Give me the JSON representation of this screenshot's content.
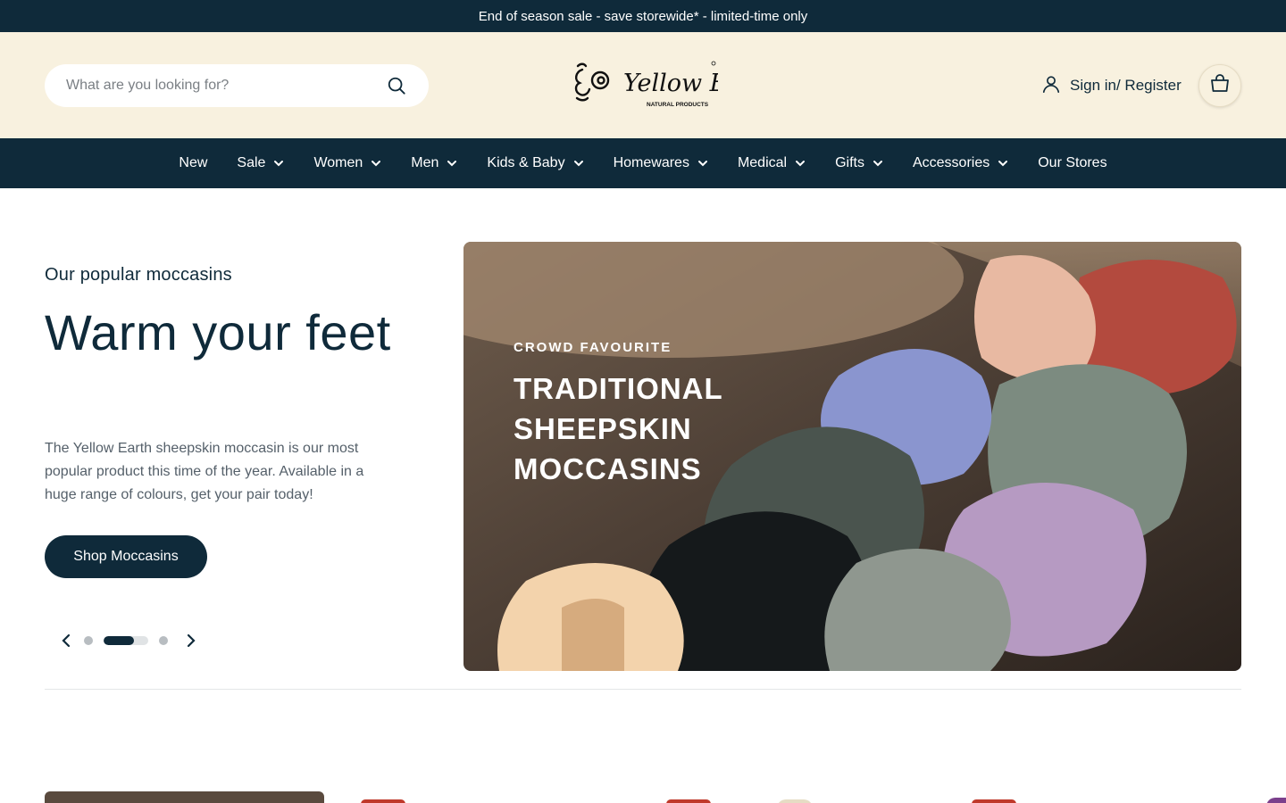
{
  "announcement": "End of season sale - save storewide* - limited-time only",
  "header": {
    "search_placeholder": "What are you looking for?",
    "logo_text": "Yellow Earth",
    "logo_tagline": "NATURAL PRODUCTS",
    "account_label": "Sign in/ Register",
    "cart_icon": "shopping-bag-icon"
  },
  "nav": {
    "items": [
      {
        "label": "New",
        "dropdown": false
      },
      {
        "label": "Sale",
        "dropdown": true
      },
      {
        "label": "Women",
        "dropdown": true
      },
      {
        "label": "Men",
        "dropdown": true
      },
      {
        "label": "Kids & Baby",
        "dropdown": true
      },
      {
        "label": "Homewares",
        "dropdown": true
      },
      {
        "label": "Medical",
        "dropdown": true
      },
      {
        "label": "Gifts",
        "dropdown": true
      },
      {
        "label": "Accessories",
        "dropdown": true
      },
      {
        "label": "Our Stores",
        "dropdown": false
      }
    ]
  },
  "hero": {
    "subtitle": "Our popular moccasins",
    "title": "Warm your feet",
    "description": "The Yellow Earth sheepskin moccasin is our most popular product this time of the year. Available in a huge range of colours, get your pair today!",
    "button_label": "Shop Moccasins",
    "image": {
      "eyebrow": "CROWD FAVOURITE",
      "headline": "TRADITIONAL SHEEPSKIN MOCCASINS"
    },
    "carousel": {
      "slides": 3,
      "active": 2
    }
  },
  "colors": {
    "primary": "#0f2a3a",
    "header_bg": "#f8f1df",
    "sale_badge": "#c0392b"
  }
}
